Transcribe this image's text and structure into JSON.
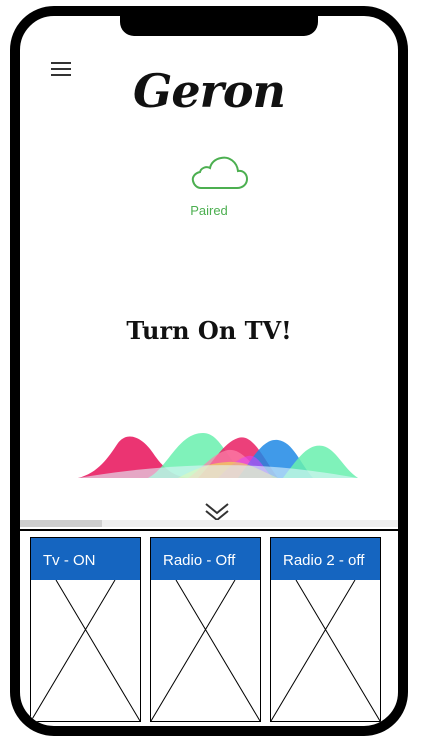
{
  "app": {
    "name": "Geron"
  },
  "status": {
    "text": "Paired",
    "icon": "cloud-icon",
    "color": "#4caf50"
  },
  "command": {
    "text": "Turn On TV!"
  },
  "icons": {
    "menu": "hamburger-menu-icon",
    "expand": "double-chevron-down-icon"
  },
  "devices": [
    {
      "label": "Tv - ON"
    },
    {
      "label": "Radio - Off"
    },
    {
      "label": "Radio 2 - off"
    }
  ],
  "colors": {
    "card_header": "#1565c0",
    "accent": "#4caf50"
  }
}
